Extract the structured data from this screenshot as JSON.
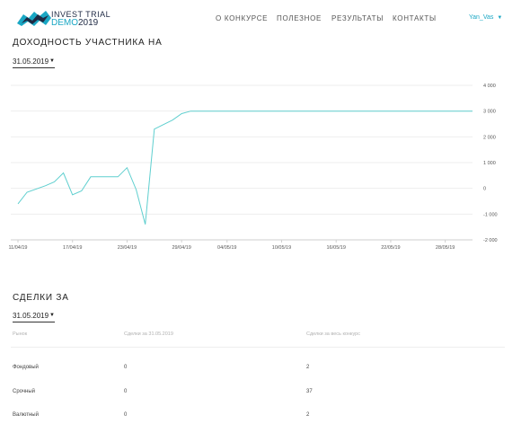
{
  "header": {
    "logo_line1": "INVEST TRIAL",
    "logo_demo": "DEMO",
    "logo_year": "2019",
    "nav": [
      "О КОНКУРСЕ",
      "ПОЛЕЗНОЕ",
      "РЕЗУЛЬТАТЫ",
      "КОНТАКТЫ"
    ],
    "user": "Yan_Vas"
  },
  "yield_section": {
    "title": "ДОХОДНОСТЬ УЧАСТНИКА НА",
    "date": "31.05.2019"
  },
  "chart_data": {
    "type": "line",
    "title": "",
    "xlabel": "",
    "ylabel": "",
    "ylim": [
      -2000,
      4000
    ],
    "grid": true,
    "color": "#5fcfcf",
    "y_ticks": [
      "4 000",
      "3 000",
      "2 000",
      "1 000",
      "0",
      "-1 000",
      "-2 000"
    ],
    "x_ticks": [
      "11/04/19",
      "17/04/19",
      "23/04/19",
      "29/04/19",
      "04/05/19",
      "10/05/19",
      "16/05/19",
      "22/05/19",
      "28/05/19"
    ],
    "series": [
      {
        "values": [
          {
            "x": "2019-04-11",
            "y": -600
          },
          {
            "x": "2019-04-12",
            "y": -150
          },
          {
            "x": "2019-04-14",
            "y": 100
          },
          {
            "x": "2019-04-15",
            "y": 250
          },
          {
            "x": "2019-04-16",
            "y": 600
          },
          {
            "x": "2019-04-17",
            "y": -250
          },
          {
            "x": "2019-04-18",
            "y": -100
          },
          {
            "x": "2019-04-19",
            "y": 450
          },
          {
            "x": "2019-04-20",
            "y": 450
          },
          {
            "x": "2019-04-21",
            "y": 450
          },
          {
            "x": "2019-04-22",
            "y": 450
          },
          {
            "x": "2019-04-23",
            "y": 800
          },
          {
            "x": "2019-04-24",
            "y": -50
          },
          {
            "x": "2019-04-25",
            "y": -1400
          },
          {
            "x": "2019-04-26",
            "y": 2300
          },
          {
            "x": "2019-04-28",
            "y": 2650
          },
          {
            "x": "2019-04-29",
            "y": 2900
          },
          {
            "x": "2019-04-30",
            "y": 3000
          },
          {
            "x": "2019-05-31",
            "y": 3000
          }
        ]
      }
    ]
  },
  "deals_section": {
    "title": "СДЕЛКИ ЗА",
    "date": "31.05.2019",
    "columns": [
      "Рынок",
      "Сделки за 31.05.2019",
      "Сделки за весь конкурс"
    ],
    "rows": [
      [
        "Фондовый",
        "0",
        "2"
      ],
      [
        "Срочный",
        "0",
        "37"
      ],
      [
        "Валютный",
        "0",
        "2"
      ]
    ]
  }
}
